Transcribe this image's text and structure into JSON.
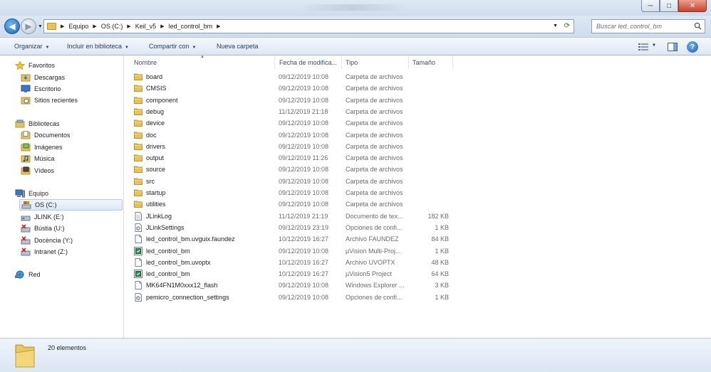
{
  "window": {
    "minimize": "─",
    "maximize": "□",
    "close": "✕"
  },
  "address": {
    "crumbs": [
      "Equipo",
      "OS (C:)",
      "Keil_v5",
      "led_control_bm"
    ],
    "search_placeholder": "Buscar led_control_bm"
  },
  "toolbar": {
    "organize": "Organizar",
    "include_library": "Incluir en biblioteca",
    "share_with": "Compartir con",
    "new_folder": "Nueva carpeta"
  },
  "nav": {
    "favorites": "Favoritos",
    "downloads": "Descargas",
    "desktop": "Escritorio",
    "recent": "Sitios recientes",
    "libraries": "Bibliotecas",
    "documents": "Documentos",
    "images": "Imágenes",
    "music": "Música",
    "videos": "Vídeos",
    "computer": "Equipo",
    "drive_c": "OS (C:)",
    "drive_e": "JLINK (E:)",
    "drive_u": "Bústia (U:)",
    "drive_y": "Docència (Y:)",
    "drive_z": "Intranet (Z:)",
    "network": "Red"
  },
  "columns": {
    "name": "Nombre",
    "date": "Fecha de modifica...",
    "type": "Tipo",
    "size": "Tamaño"
  },
  "files": [
    {
      "icon": "folder-icon",
      "name": "board",
      "date": "09/12/2019 10:08",
      "type": "Carpeta de archivos",
      "size": ""
    },
    {
      "icon": "folder-icon",
      "name": "CMSIS",
      "date": "09/12/2019 10:08",
      "type": "Carpeta de archivos",
      "size": ""
    },
    {
      "icon": "folder-icon",
      "name": "component",
      "date": "09/12/2019 10:08",
      "type": "Carpeta de archivos",
      "size": ""
    },
    {
      "icon": "folder-icon",
      "name": "debug",
      "date": "11/12/2019 21:18",
      "type": "Carpeta de archivos",
      "size": ""
    },
    {
      "icon": "folder-icon",
      "name": "device",
      "date": "09/12/2019 10:08",
      "type": "Carpeta de archivos",
      "size": ""
    },
    {
      "icon": "folder-icon",
      "name": "doc",
      "date": "09/12/2019 10:08",
      "type": "Carpeta de archivos",
      "size": ""
    },
    {
      "icon": "folder-icon",
      "name": "drivers",
      "date": "09/12/2019 10:08",
      "type": "Carpeta de archivos",
      "size": ""
    },
    {
      "icon": "folder-icon",
      "name": "output",
      "date": "09/12/2019 11:26",
      "type": "Carpeta de archivos",
      "size": ""
    },
    {
      "icon": "folder-icon",
      "name": "source",
      "date": "09/12/2019 10:08",
      "type": "Carpeta de archivos",
      "size": ""
    },
    {
      "icon": "folder-icon",
      "name": "src",
      "date": "09/12/2019 10:08",
      "type": "Carpeta de archivos",
      "size": ""
    },
    {
      "icon": "folder-icon",
      "name": "startup",
      "date": "09/12/2019 10:08",
      "type": "Carpeta de archivos",
      "size": ""
    },
    {
      "icon": "folder-icon",
      "name": "utilities",
      "date": "09/12/2019 10:08",
      "type": "Carpeta de archivos",
      "size": ""
    },
    {
      "icon": "text-file-icon",
      "name": "JLinkLog",
      "date": "11/12/2019 21:19",
      "type": "Documento de tex...",
      "size": "182 KB"
    },
    {
      "icon": "settings-file-icon",
      "name": "JLinkSettings",
      "date": "09/12/2019 23:19",
      "type": "Opciones de confi...",
      "size": "1 KB"
    },
    {
      "icon": "blank-file-icon",
      "name": "led_control_bm.uvguix.faundez",
      "date": "10/12/2019 16:27",
      "type": "Archivo FAUNDEZ",
      "size": "84 KB"
    },
    {
      "icon": "uvision-file-icon",
      "name": "led_control_bm",
      "date": "09/12/2019 10:08",
      "type": "µVision Multi-Proj...",
      "size": "1 KB"
    },
    {
      "icon": "blank-file-icon",
      "name": "led_control_bm.uvoptx",
      "date": "10/12/2019 16:27",
      "type": "Archivo UVOPTX",
      "size": "48 KB"
    },
    {
      "icon": "uvision-file-icon",
      "name": "led_control_bm",
      "date": "10/12/2019 16:27",
      "type": "µVision5 Project",
      "size": "64 KB"
    },
    {
      "icon": "blank-file-icon",
      "name": "MK64FN1M0xxx12_flash",
      "date": "09/12/2019 10:08",
      "type": "Windows Explorer ...",
      "size": "3 KB"
    },
    {
      "icon": "settings-file-icon",
      "name": "pemicro_connection_settings",
      "date": "09/12/2019 10:08",
      "type": "Opciones de confi...",
      "size": "1 KB"
    }
  ],
  "status": {
    "count": "20 elementos"
  }
}
